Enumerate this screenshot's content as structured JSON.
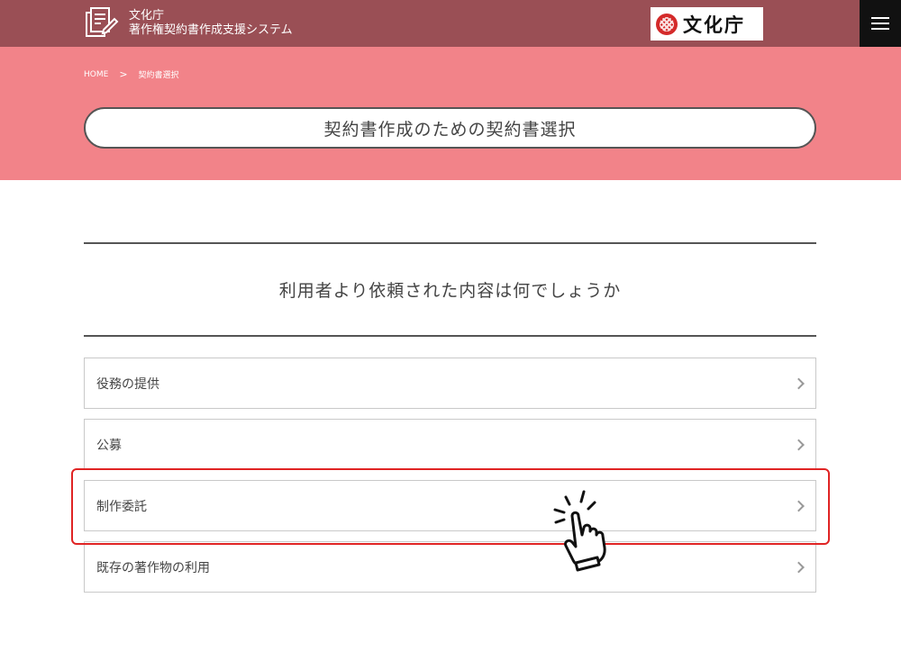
{
  "header": {
    "site_name_line1": "文化庁",
    "site_name_line2": "著作権契約書作成支援システム",
    "agency_logo_text": "文化庁"
  },
  "breadcrumb": {
    "home": "HOME",
    "separator": ">",
    "current": "契約書選択"
  },
  "page": {
    "title": "契約書作成のための契約書選択",
    "question": "利用者より依頼された内容は何でしょうか"
  },
  "options": [
    {
      "label": "役務の提供"
    },
    {
      "label": "公募"
    },
    {
      "label": "制作委託"
    },
    {
      "label": "既存の著作物の利用"
    }
  ],
  "colors": {
    "header_bg": "#9a4f55",
    "hero_bg": "#f28389",
    "highlight": "#e02424"
  },
  "icons": [
    "document-icon",
    "agency-logo-icon",
    "menu-icon",
    "chevron-right-icon",
    "hand-pointer-icon"
  ]
}
